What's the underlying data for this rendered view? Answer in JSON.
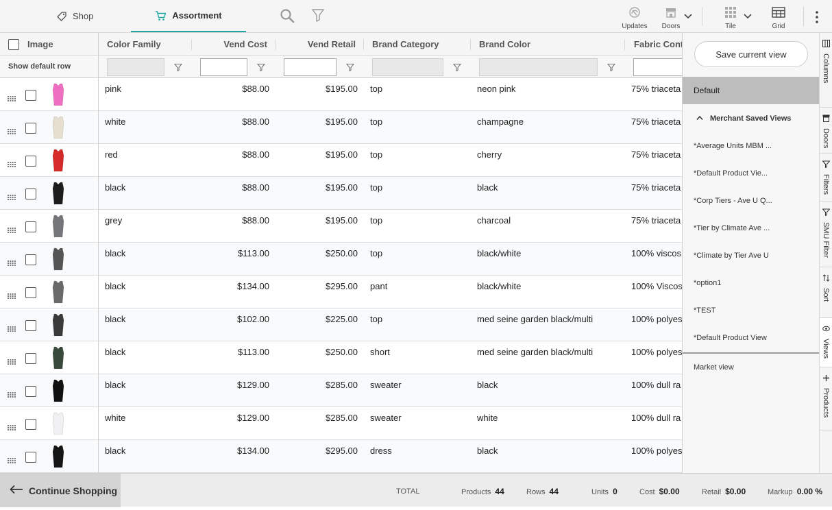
{
  "nav": {
    "shop_label": "Shop",
    "assortment_label": "Assortment",
    "accent_color": "#1ea6a1"
  },
  "toolbar": {
    "updates_label": "Updates",
    "doors_label": "Doors",
    "tile_label": "Tile",
    "grid_label": "Grid"
  },
  "table": {
    "columns": [
      "Image",
      "Color Family",
      "Vend Cost",
      "Vend Retail",
      "Brand Category",
      "Brand Color",
      "Fabric Cont"
    ],
    "show_default_row": "Show default row",
    "rows": [
      {
        "thumb_color": "#ee6fc0",
        "color_family": "pink",
        "vend_cost": "$88.00",
        "vend_retail": "$195.00",
        "brand_category": "top",
        "brand_color": "neon pink",
        "fabric": "75% triaceta"
      },
      {
        "thumb_color": "#e6dfcf",
        "color_family": "white",
        "vend_cost": "$88.00",
        "vend_retail": "$195.00",
        "brand_category": "top",
        "brand_color": "champagne",
        "fabric": "75% triaceta"
      },
      {
        "thumb_color": "#d42a2a",
        "color_family": "red",
        "vend_cost": "$88.00",
        "vend_retail": "$195.00",
        "brand_category": "top",
        "brand_color": "cherry",
        "fabric": "75% triaceta"
      },
      {
        "thumb_color": "#1d1d1d",
        "color_family": "black",
        "vend_cost": "$88.00",
        "vend_retail": "$195.00",
        "brand_category": "top",
        "brand_color": "black",
        "fabric": "75% triaceta"
      },
      {
        "thumb_color": "#75767a",
        "color_family": "grey",
        "vend_cost": "$88.00",
        "vend_retail": "$195.00",
        "brand_category": "top",
        "brand_color": "charcoal",
        "fabric": "75% triaceta"
      },
      {
        "thumb_color": "#555555",
        "color_family": "black",
        "vend_cost": "$113.00",
        "vend_retail": "$250.00",
        "brand_category": "top",
        "brand_color": "black/white",
        "fabric": "100% viscos"
      },
      {
        "thumb_color": "#6a6a6a",
        "color_family": "black",
        "vend_cost": "$134.00",
        "vend_retail": "$295.00",
        "brand_category": "pant",
        "brand_color": "black/white",
        "fabric": "100% Viscos"
      },
      {
        "thumb_color": "#3a3a3a",
        "color_family": "black",
        "vend_cost": "$102.00",
        "vend_retail": "$225.00",
        "brand_category": "top",
        "brand_color": "med seine garden black/multi",
        "fabric": "100% polyes"
      },
      {
        "thumb_color": "#3a4a3a",
        "color_family": "black",
        "vend_cost": "$113.00",
        "vend_retail": "$250.00",
        "brand_category": "short",
        "brand_color": "med seine garden black/multi",
        "fabric": "100% polyes"
      },
      {
        "thumb_color": "#111111",
        "color_family": "black",
        "vend_cost": "$129.00",
        "vend_retail": "$285.00",
        "brand_category": "sweater",
        "brand_color": "black",
        "fabric": "100% dull ra"
      },
      {
        "thumb_color": "#f0f0f2",
        "color_family": "white",
        "vend_cost": "$129.00",
        "vend_retail": "$285.00",
        "brand_category": "sweater",
        "brand_color": "white",
        "fabric": "100% dull ra"
      },
      {
        "thumb_color": "#151515",
        "color_family": "black",
        "vend_cost": "$134.00",
        "vend_retail": "$295.00",
        "brand_category": "dress",
        "brand_color": "black",
        "fabric": "100% polyes"
      }
    ]
  },
  "views_panel": {
    "save_button": "Save current view",
    "default_view": "Default",
    "group_title": "Merchant Saved Views",
    "saved_views": [
      "*Average Units MBM ...",
      "*Default Product Vie...",
      "*Corp Tiers - Ave U Q...",
      "*Tier by Climate Ave ...",
      "*Climate by Tier Ave U",
      "*option1",
      "*TEST",
      "*Default Product View"
    ],
    "market_view": "Market view"
  },
  "side_tabs": [
    "Columns",
    "Doors",
    "Filters",
    "SMU Filter",
    "Sort",
    "Views",
    "Products"
  ],
  "footer": {
    "continue_label": "Continue Shopping",
    "total_label": "TOTAL",
    "products_label": "Products",
    "products_value": "44",
    "rows_label": "Rows",
    "rows_value": "44",
    "units_label": "Units",
    "units_value": "0",
    "cost_label": "Cost",
    "cost_value": "$0.00",
    "retail_label": "Retail",
    "retail_value": "$0.00",
    "markup_label": "Markup",
    "markup_value": "0.00 %"
  }
}
